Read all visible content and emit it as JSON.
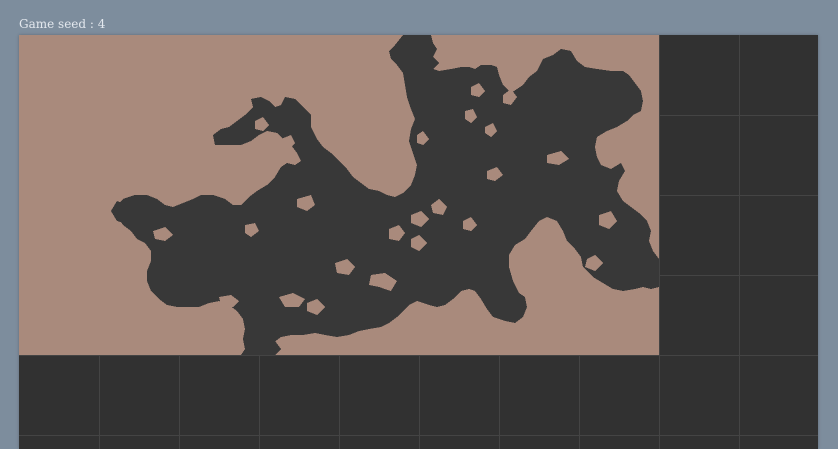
{
  "header": {
    "seed_text": "Game seed : 4"
  },
  "board": {
    "background_color": "#313131",
    "grid_line_color": "#414141",
    "cell_columns": 10,
    "cell_rows_visible": 6
  },
  "map": {
    "land_color": "#a98a7c",
    "ground_color": "#383838",
    "description_icon": "cave-map"
  }
}
